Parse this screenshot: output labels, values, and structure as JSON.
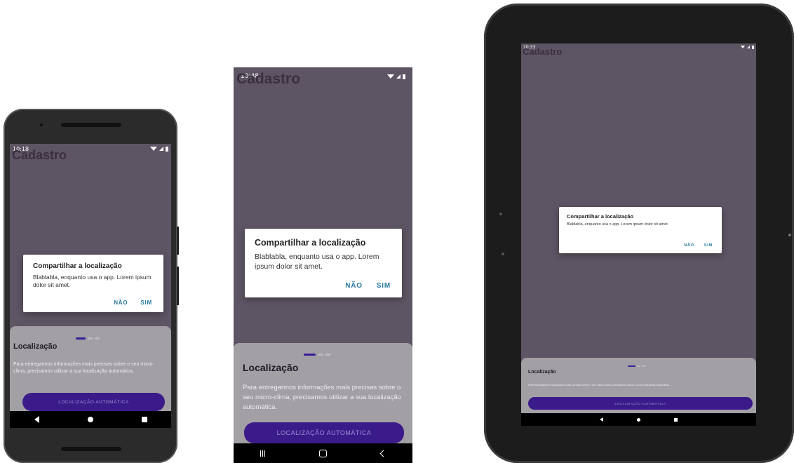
{
  "app_title": "Cadastro",
  "dialog": {
    "title": "Compartilhar a localização",
    "message": "Blablabla, enquanto usa o app. Lorem ipsum dolor sit amet.",
    "negative_label": "NÃO",
    "positive_label": "SIM"
  },
  "sheet": {
    "title": "Localização",
    "body": "Para entregarmos informações mais precisas sobre o seu micro-clima, precisamos utilizar a sua localização automática.",
    "cta_label": "LOCALIZAÇÃO AUTOMÁTICA"
  },
  "devices": {
    "phone_pixel": {
      "time": "10:18"
    },
    "phone_samsung": {
      "time": "10:48"
    },
    "tablet": {
      "time": "10:33"
    }
  },
  "colors": {
    "overlay": "#5e5564",
    "dialog_action": "#27789e",
    "cta": "#3b1b8a",
    "indicator_active": "#3a1b9a"
  },
  "icons": [
    "wifi-icon",
    "signal-icon",
    "battery-icon",
    "nav-back-icon",
    "nav-home-icon",
    "nav-recents-icon"
  ]
}
